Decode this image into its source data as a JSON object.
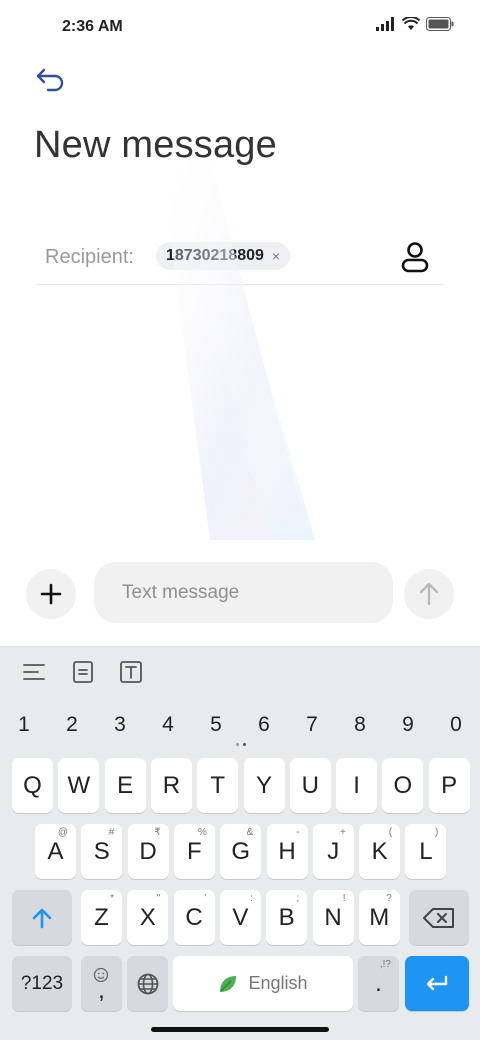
{
  "status_bar": {
    "time": "2:36 AM"
  },
  "header": {
    "title": "New message"
  },
  "recipient": {
    "label": "Recipient:",
    "chip_number": "18730218809",
    "chip_remove": "×"
  },
  "compose": {
    "placeholder": "Text message"
  },
  "keyboard": {
    "numbers": [
      "1",
      "2",
      "3",
      "4",
      "5",
      "6",
      "7",
      "8",
      "9",
      "0"
    ],
    "row1": [
      {
        "key": "Q",
        "sup": ""
      },
      {
        "key": "W",
        "sup": ""
      },
      {
        "key": "E",
        "sup": ""
      },
      {
        "key": "R",
        "sup": ""
      },
      {
        "key": "T",
        "sup": ""
      },
      {
        "key": "Y",
        "sup": ""
      },
      {
        "key": "U",
        "sup": ""
      },
      {
        "key": "I",
        "sup": ""
      },
      {
        "key": "O",
        "sup": ""
      },
      {
        "key": "P",
        "sup": ""
      }
    ],
    "row2": [
      {
        "key": "A",
        "sup": "@"
      },
      {
        "key": "S",
        "sup": "#"
      },
      {
        "key": "D",
        "sup": "₹"
      },
      {
        "key": "F",
        "sup": "%"
      },
      {
        "key": "G",
        "sup": "&"
      },
      {
        "key": "H",
        "sup": "-"
      },
      {
        "key": "J",
        "sup": "+"
      },
      {
        "key": "K",
        "sup": "("
      },
      {
        "key": "L",
        "sup": ")"
      }
    ],
    "row3": [
      {
        "key": "Z",
        "sup": "*"
      },
      {
        "key": "X",
        "sup": "\""
      },
      {
        "key": "C",
        "sup": "'"
      },
      {
        "key": "V",
        "sup": ":"
      },
      {
        "key": "B",
        "sup": ";"
      },
      {
        "key": "N",
        "sup": "!"
      },
      {
        "key": "M",
        "sup": "?"
      }
    ],
    "symbols_label": "?123",
    "comma": ",",
    "space_label": "English",
    "period": ".",
    "period_sup": ",!?"
  },
  "colors": {
    "accent_blue": "#1e95f2",
    "keyboard_bg": "#e8ebee",
    "key_dark": "#d6dade"
  },
  "icons": {
    "back": "back-arrow-icon",
    "contact": "contact-person-icon",
    "add": "plus-icon",
    "send": "send-arrow-icon",
    "shift": "shift-arrow-icon",
    "backspace": "backspace-icon",
    "globe": "globe-icon",
    "enter": "enter-icon",
    "leaf": "leaf-icon",
    "emoji": "emoji-icon"
  }
}
